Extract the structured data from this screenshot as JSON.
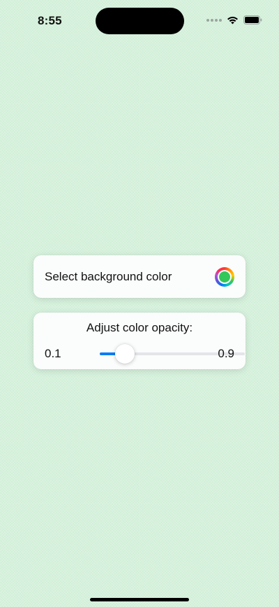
{
  "status_bar": {
    "time": "8:55",
    "icons": [
      "cellular-dots-icon",
      "wifi-icon",
      "battery-icon"
    ]
  },
  "color_picker": {
    "label": "Select background color",
    "selected_color": "#34c759"
  },
  "opacity": {
    "title": "Adjust color opacity:",
    "min_label": "0.1",
    "max_label": "0.9",
    "min": 0.1,
    "max": 0.9,
    "value": 0.24,
    "accent_color": "#0a7cf5"
  },
  "colors": {
    "background": "#d2efd9",
    "card": "#fbfcfc"
  }
}
